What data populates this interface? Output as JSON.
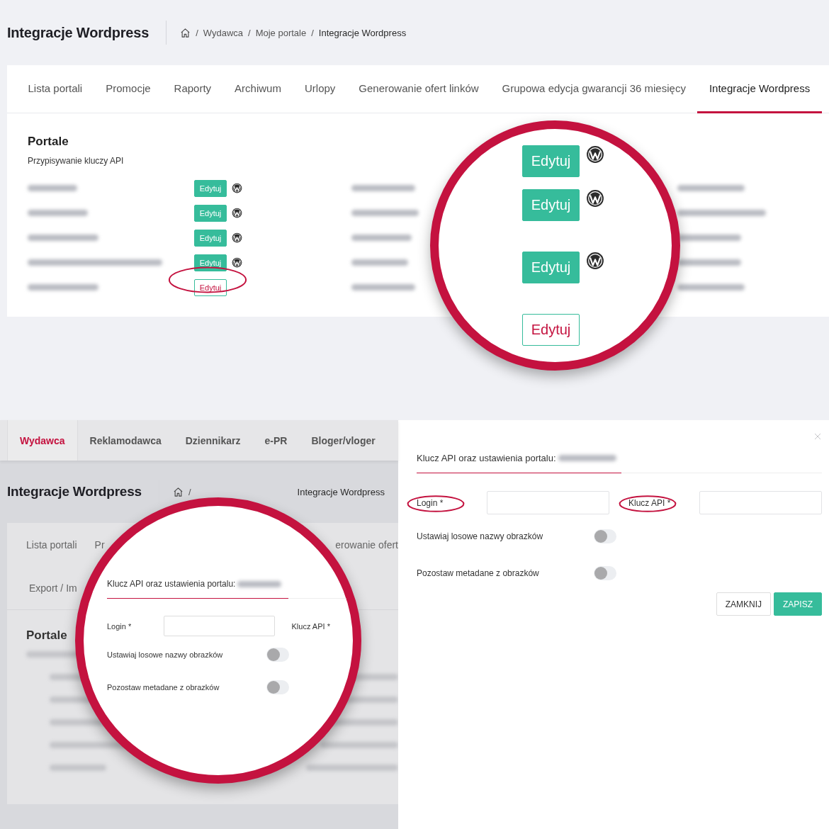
{
  "top": {
    "header": {
      "title": "Integracje Wordpress",
      "separator": "/",
      "breadcrumb": [
        "Wydawca",
        "Moje portale",
        "Integracje Wordpress"
      ]
    },
    "tabs": [
      {
        "label": "Lista portali",
        "selected": false
      },
      {
        "label": "Promocje",
        "selected": false
      },
      {
        "label": "Raporty",
        "selected": false
      },
      {
        "label": "Archiwum",
        "selected": false
      },
      {
        "label": "Urlopy",
        "selected": false
      },
      {
        "label": "Generowanie ofert linków",
        "selected": false
      },
      {
        "label": "Grupowa edycja gwarancji 36 miesięcy",
        "selected": false
      },
      {
        "label": "Integracje Wordpress",
        "selected": true
      }
    ],
    "section": {
      "title": "Portale",
      "subtitle": "Przypisywanie kluczy API"
    },
    "portals": [
      {
        "button": "Edytuj",
        "configured": true,
        "highlighted": false
      },
      {
        "button": "Edytuj",
        "configured": true,
        "highlighted": false
      },
      {
        "button": "Edytuj",
        "configured": true,
        "highlighted": false
      },
      {
        "button": "Edytuj",
        "configured": true,
        "highlighted": false
      },
      {
        "button": "Edytuj",
        "configured": false,
        "highlighted": true
      }
    ],
    "magnifier": [
      {
        "button": "Edytuj",
        "configured": true
      },
      {
        "button": "Edytuj",
        "configured": true
      },
      {
        "button": "Edytuj",
        "configured": true
      },
      {
        "button": "Edytuj",
        "configured": false
      }
    ]
  },
  "bottom": {
    "nav": [
      {
        "label": "Wydawca",
        "selected": true
      },
      {
        "label": "Reklamodawca",
        "selected": false
      },
      {
        "label": "Dziennikarz",
        "selected": false
      },
      {
        "label": "e-PR",
        "selected": false
      },
      {
        "label": "Bloger/vloger",
        "selected": false
      }
    ],
    "header": {
      "title": "Integracje Wordpress",
      "separator": "/",
      "breadcrumb": [
        "Integracje Wordpress"
      ]
    },
    "tabs": [
      {
        "label": "Lista portali",
        "selected": false
      },
      {
        "label": "Pr",
        "selected": false
      },
      {
        "label": "erowanie ofert",
        "selected": false
      },
      {
        "label": "Export / Im",
        "selected": false
      }
    ],
    "section_title": "Portale",
    "magnifier": {
      "heading": "Klucz API oraz ustawienia portalu:",
      "fields": [
        {
          "label": "Login *",
          "kind": "input"
        },
        {
          "label": "Klucz API *",
          "kind": "label"
        }
      ],
      "toggles": [
        {
          "label": "Ustawiaj losowe nazwy obrazków",
          "on": false
        },
        {
          "label": "Pozostaw metadane z obrazków",
          "on": false
        }
      ]
    }
  },
  "dialog": {
    "heading": "Klucz API oraz ustawienia portalu:",
    "fields": [
      {
        "label": "Login *",
        "kind": "input",
        "highlighted": true
      },
      {
        "label": "Klucz API *",
        "kind": "input",
        "highlighted": true
      }
    ],
    "toggles": [
      {
        "label": "Ustawiaj losowe nazwy obrazków",
        "on": false
      },
      {
        "label": "Pozostaw metadane z obrazków",
        "on": false
      }
    ],
    "buttons": [
      {
        "label": "ZAMKNIJ",
        "kind": "secondary"
      },
      {
        "label": "ZAPISZ",
        "kind": "primary"
      }
    ]
  }
}
